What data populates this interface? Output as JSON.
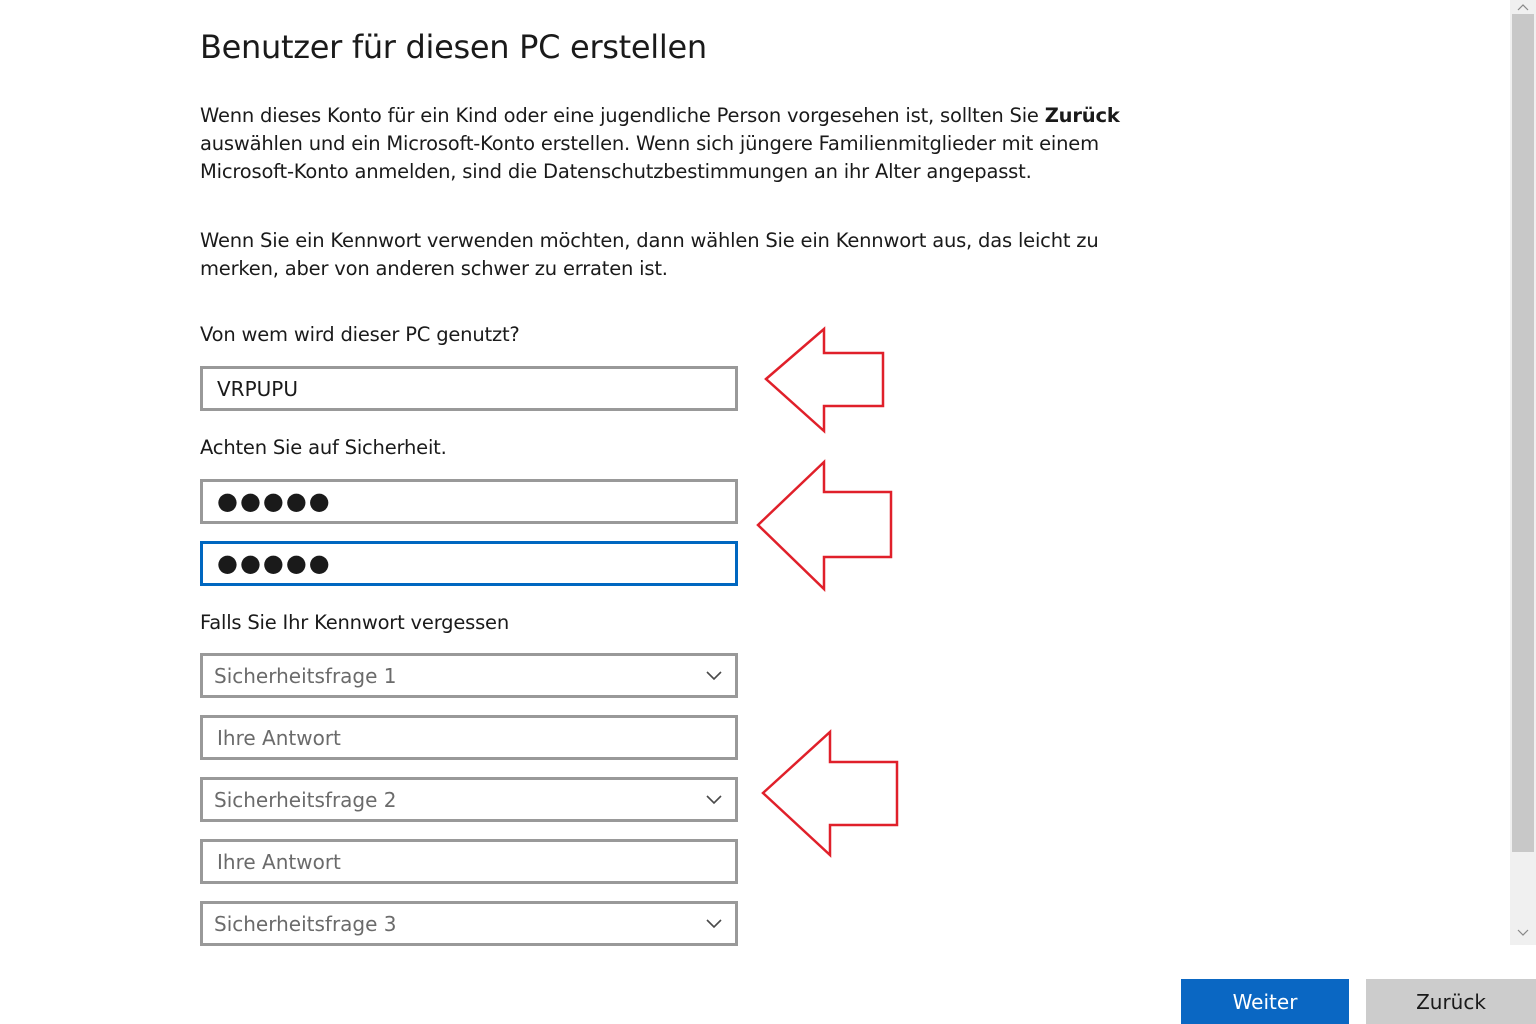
{
  "page": {
    "title": "Benutzer für diesen PC erstellen",
    "intro_part1": "Wenn dieses Konto für ein Kind oder eine jugendliche Person vorgesehen ist, sollten Sie ",
    "intro_bold": "Zurück",
    "intro_part2": " auswählen und ein Microsoft-Konto erstellen. Wenn sich jüngere Familienmitglieder mit einem Microsoft-Konto anmelden, sind die Datenschutzbestimmungen an ihr Alter angepasst.",
    "password_hint": "Wenn Sie ein Kennwort verwenden möchten, dann wählen Sie ein Kennwort aus, das leicht zu merken, aber von anderen schwer zu erraten ist."
  },
  "form": {
    "username_label": "Von wem wird dieser PC genutzt?",
    "username_value": "VRPUPU",
    "security_label": "Achten Sie auf Sicherheit.",
    "password_value": "●●●●●",
    "password_confirm_value": "●●●●●",
    "recovery_label": "Falls Sie Ihr Kennwort vergessen",
    "question1": "Sicherheitsfrage 1",
    "answer1_placeholder": "Ihre Antwort",
    "question2": "Sicherheitsfrage 2",
    "answer2_placeholder": "Ihre Antwort",
    "question3": "Sicherheitsfrage 3"
  },
  "buttons": {
    "next": "Weiter",
    "back": "Zurück"
  },
  "colors": {
    "accent": "#0a67c3",
    "focus_border": "#0067c0",
    "annotation_arrow": "#e0202a"
  },
  "icons": {
    "dropdown": "chevron-down-icon",
    "annotation": "arrow-left-outline-icon"
  }
}
